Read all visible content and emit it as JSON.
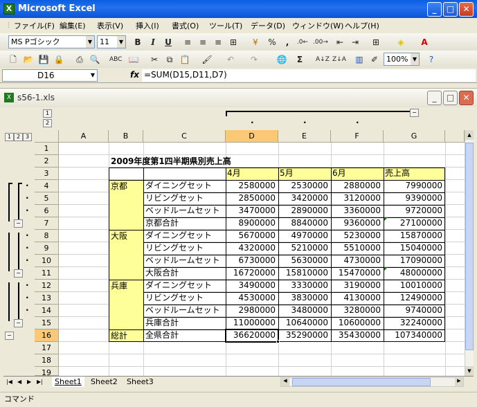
{
  "app": {
    "title": "Microsoft Excel",
    "icon": "X"
  },
  "menu": [
    "ファイル(F)",
    "編集(E)",
    "表示(V)",
    "挿入(I)",
    "書式(O)",
    "ツール(T)",
    "データ(D)",
    "ウィンドウ(W)",
    "ヘルプ(H)"
  ],
  "format": {
    "font": "MS Pゴシック",
    "size": "11",
    "bold": "B",
    "italic": "I",
    "underline": "U",
    "percent": "%",
    "comma": ",",
    "font_color_glyph": "A"
  },
  "standard": {
    "zoom": "100%",
    "sum": "Σ"
  },
  "formula": {
    "cell": "D16",
    "fx": "fx",
    "content": "=SUM(D15,D11,D7)"
  },
  "workbook": {
    "title": "s56-1.xls"
  },
  "outline": {
    "col_levels": [
      "1",
      "2"
    ],
    "row_levels": [
      "1",
      "2",
      "3"
    ],
    "minus": "−",
    "dot": "·"
  },
  "columns": [
    "A",
    "B",
    "C",
    "D",
    "E",
    "F",
    "G"
  ],
  "rows": [
    "1",
    "2",
    "3",
    "4",
    "5",
    "6",
    "7",
    "8",
    "9",
    "10",
    "11",
    "12",
    "13",
    "14",
    "15",
    "16",
    "17",
    "18",
    "19"
  ],
  "sheet": {
    "title": "2009年度第1四半期県別売上高",
    "headers": [
      "4月",
      "5月",
      "6月",
      "売上高"
    ],
    "groups": [
      {
        "pref": "京都",
        "items": [
          {
            "label": "ダイニングセット",
            "v": [
              "2580000",
              "2530000",
              "2880000",
              "7990000"
            ]
          },
          {
            "label": "リビングセット",
            "v": [
              "2850000",
              "3420000",
              "3120000",
              "9390000"
            ]
          },
          {
            "label": "ベッドルームセット",
            "v": [
              "3470000",
              "2890000",
              "3360000",
              "9720000"
            ]
          },
          {
            "label": "京都合計",
            "v": [
              "8900000",
              "8840000",
              "9360000",
              "27100000"
            ]
          }
        ]
      },
      {
        "pref": "大阪",
        "items": [
          {
            "label": "ダイニングセット",
            "v": [
              "5670000",
              "4970000",
              "5230000",
              "15870000"
            ]
          },
          {
            "label": "リビングセット",
            "v": [
              "4320000",
              "5210000",
              "5510000",
              "15040000"
            ]
          },
          {
            "label": "ベッドルームセット",
            "v": [
              "6730000",
              "5630000",
              "4730000",
              "17090000"
            ]
          },
          {
            "label": "大阪合計",
            "v": [
              "16720000",
              "15810000",
              "15470000",
              "48000000"
            ]
          }
        ]
      },
      {
        "pref": "兵庫",
        "items": [
          {
            "label": "ダイニングセット",
            "v": [
              "3490000",
              "3330000",
              "3190000",
              "10010000"
            ]
          },
          {
            "label": "リビングセット",
            "v": [
              "4530000",
              "3830000",
              "4130000",
              "12490000"
            ]
          },
          {
            "label": "ベッドルームセット",
            "v": [
              "2980000",
              "3480000",
              "3280000",
              "9740000"
            ]
          },
          {
            "label": "兵庫合計",
            "v": [
              "11000000",
              "10640000",
              "10600000",
              "32240000"
            ]
          }
        ]
      }
    ],
    "total": {
      "pref": "総計",
      "label": "全県合計",
      "v": [
        "36620000",
        "35290000",
        "35430000",
        "107340000"
      ]
    }
  },
  "tabs": [
    "Sheet1",
    "Sheet2",
    "Sheet3"
  ],
  "status": "コマンド",
  "colors": {
    "highlight": "#ffff99",
    "selected_header": "#f9c978",
    "title_bar": "#0a5fe0"
  }
}
